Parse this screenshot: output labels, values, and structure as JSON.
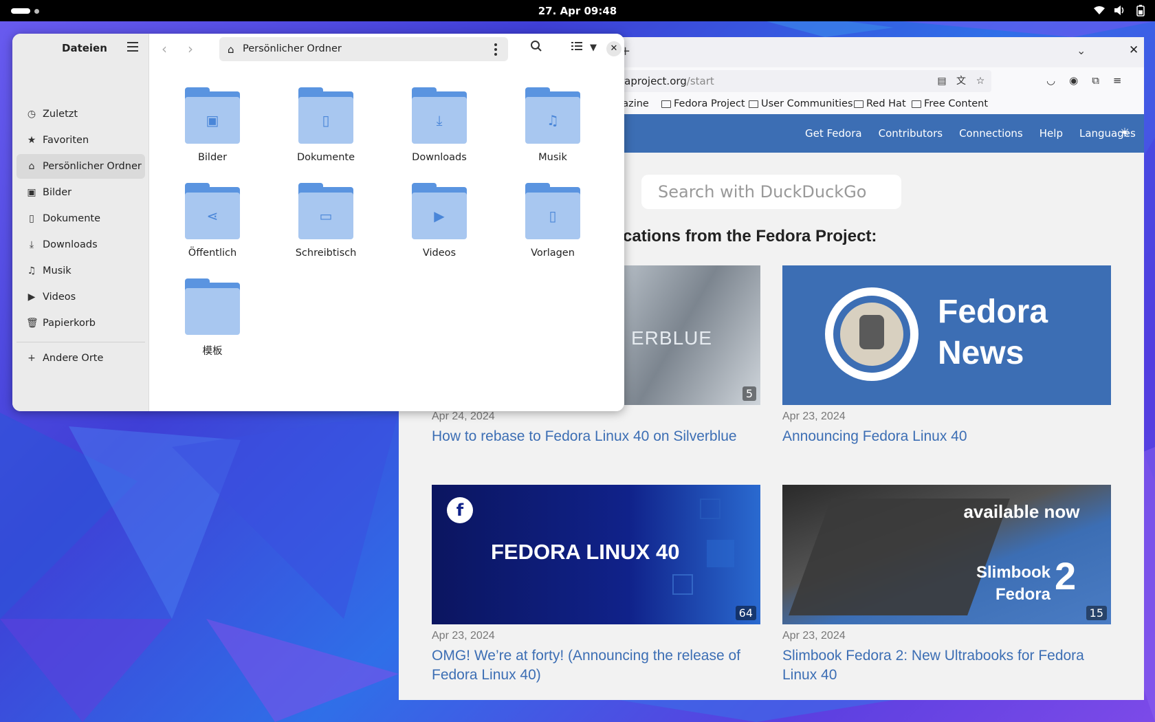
{
  "topbar": {
    "clock": "27. Apr  09:48"
  },
  "browser": {
    "url_domain": "raproject.org",
    "url_path": "/start",
    "bookmarks": [
      "gazine",
      "Fedora Project",
      "User Communities",
      "Red Hat",
      "Free Content"
    ],
    "header_links": [
      "Get Fedora",
      "Contributors",
      "Connections",
      "Help",
      "Languages"
    ],
    "search_placeholder": "Search with DuckDuckGo",
    "heading": "cations from the Fedora Project:",
    "cards": [
      {
        "date": "Apr 24, 2024",
        "title": "How to rebase to Fedora Linux 40 on Silverblue",
        "count": "5",
        "thumb_text": "ERBLUE"
      },
      {
        "date": "Apr 23, 2024",
        "title": "Announcing Fedora Linux 40",
        "thumb_text_1": "Fedora",
        "thumb_text_2": "News"
      },
      {
        "date": "Apr 23, 2024",
        "title": "OMG! We’re at forty! (Announcing the release of Fedora Linux 40)",
        "count": "64",
        "thumb_text": "FEDORA LINUX 40"
      },
      {
        "date": "Apr 23, 2024",
        "title": "Slimbook Fedora 2: New Ultrabooks for Fedora Linux 40",
        "count": "15",
        "thumb_text_1": "available now",
        "thumb_text_2": "Slimbook Fedora",
        "thumb_text_3": "2"
      }
    ]
  },
  "files": {
    "title": "Dateien",
    "path": "Persönlicher Ordner",
    "sidebar": [
      {
        "label": "Zuletzt",
        "icon": "clock-icon"
      },
      {
        "label": "Favoriten",
        "icon": "star-icon"
      },
      {
        "label": "Persönlicher Ordner",
        "icon": "home-icon"
      },
      {
        "label": "Bilder",
        "icon": "image-icon"
      },
      {
        "label": "Dokumente",
        "icon": "document-icon"
      },
      {
        "label": "Downloads",
        "icon": "download-icon"
      },
      {
        "label": "Musik",
        "icon": "music-icon"
      },
      {
        "label": "Videos",
        "icon": "video-icon"
      },
      {
        "label": "Papierkorb",
        "icon": "trash-icon"
      }
    ],
    "other_locations": "Andere Orte",
    "folders": [
      {
        "label": "Bilder",
        "icon": "image-icon"
      },
      {
        "label": "Dokumente",
        "icon": "document-icon"
      },
      {
        "label": "Downloads",
        "icon": "download-icon"
      },
      {
        "label": "Musik",
        "icon": "music-icon"
      },
      {
        "label": "Öffentlich",
        "icon": "share-icon"
      },
      {
        "label": "Schreibtisch",
        "icon": "folder-icon"
      },
      {
        "label": "Videos",
        "icon": "video-icon"
      },
      {
        "label": "Vorlagen",
        "icon": "template-icon"
      },
      {
        "label": "模板",
        "icon": "folder-icon"
      }
    ]
  }
}
